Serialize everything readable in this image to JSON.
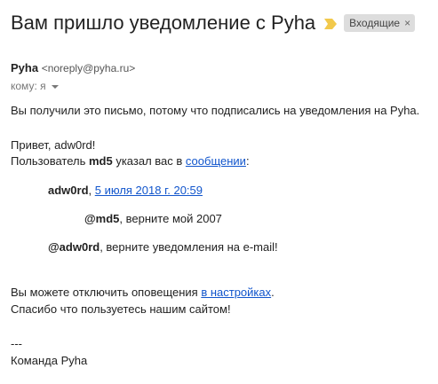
{
  "header": {
    "subject": "Вам пришло уведомление с Pyha",
    "label": "Входящие",
    "label_close": "×",
    "important_color": "#f2c94c",
    "important_icon": "important-marker-icon"
  },
  "sender": {
    "name": "Pyha",
    "email": "<noreply@pyha.ru>",
    "recipient_text": "кому: я"
  },
  "body": {
    "intro": "Вы получили это письмо, потому что подписались на уведомления на Pyha.",
    "greeting": "Привет, adw0rd!",
    "mention_prefix": "Пользователь ",
    "mention_user": "md5",
    "mention_middle": " указал вас в ",
    "mention_link": "сообщении",
    "mention_suffix": ":",
    "quote_author": "adw0rd",
    "quote_sep": ", ",
    "quote_date_link": "5 июля 2018 г. 20:59",
    "nested_user": "@md5",
    "nested_text": ", верните мой 2007",
    "reply_user": "@adw0rd",
    "reply_text": ", верните уведомления на e-mail!",
    "unsubscribe_prefix": "Вы можете отключить оповещения ",
    "unsubscribe_link": "в настройках",
    "unsubscribe_suffix": ".",
    "thanks": "Спасибо что пользуетесь нашим сайтом!",
    "signature_sep": "---",
    "signature": "Команда Pyha"
  }
}
